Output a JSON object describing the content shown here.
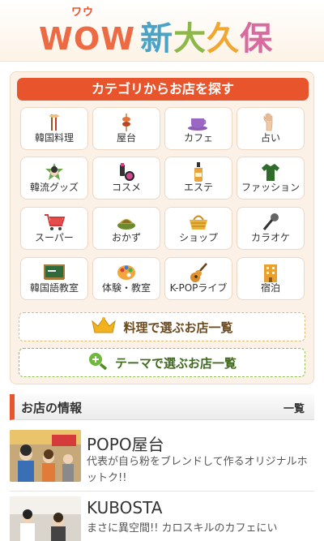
{
  "header": {
    "logo_small": "ワウ",
    "logo_wow": "WOW",
    "logo_jp": [
      "新",
      "大",
      "久",
      "保"
    ]
  },
  "category": {
    "title": "カテゴリからお店を探す",
    "items": [
      {
        "label": "韓国料理",
        "icon": "chopsticks-icon"
      },
      {
        "label": "屋台",
        "icon": "skewer-icon"
      },
      {
        "label": "カフェ",
        "icon": "coffee-cup-icon"
      },
      {
        "label": "占い",
        "icon": "palm-icon"
      },
      {
        "label": "韓流グッズ",
        "icon": "star-photo-icon"
      },
      {
        "label": "コスメ",
        "icon": "cosmetics-icon"
      },
      {
        "label": "エステ",
        "icon": "oil-bottle-icon"
      },
      {
        "label": "ファッション",
        "icon": "shirt-icon"
      },
      {
        "label": "スーパー",
        "icon": "shopping-cart-icon"
      },
      {
        "label": "おかず",
        "icon": "side-dish-icon"
      },
      {
        "label": "ショップ",
        "icon": "basket-icon"
      },
      {
        "label": "カラオケ",
        "icon": "microphone-icon"
      },
      {
        "label": "韓国語教室",
        "icon": "blackboard-icon"
      },
      {
        "label": "体験・教室",
        "icon": "palette-icon"
      },
      {
        "label": "K-POPライブ",
        "icon": "guitar-icon"
      },
      {
        "label": "宿泊",
        "icon": "building-icon"
      }
    ],
    "by_food": "料理で選ぶお店一覧",
    "by_theme": "テーマで選ぶお店一覧"
  },
  "shops_section": {
    "title": "お店の情報",
    "more": "一覧",
    "shops": [
      {
        "name": "POPO屋台",
        "desc": "代表が自ら粉をブレンドして作るオリジナルホットク!!"
      },
      {
        "name": "KUBOSTA",
        "desc": "まさに異空間!! カロスキルのカフェにい"
      }
    ]
  }
}
